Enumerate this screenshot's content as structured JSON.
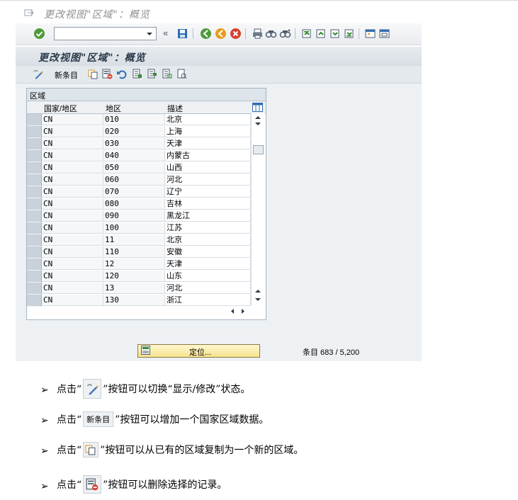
{
  "window": {
    "title": "更改视图\"区域\"：概览",
    "screen_title": "更改视图\"区域\"：概览"
  },
  "toolbar": {
    "command_field_value": "",
    "command_field_placeholder": ""
  },
  "app_toolbar": {
    "new_entries_label": "新条目"
  },
  "table": {
    "group_title": "区域",
    "headers": [
      "国家/地区",
      "地区",
      "描述"
    ],
    "rows": [
      {
        "country": "CN",
        "region": "010",
        "desc": "北京"
      },
      {
        "country": "CN",
        "region": "020",
        "desc": "上海"
      },
      {
        "country": "CN",
        "region": "030",
        "desc": "天津"
      },
      {
        "country": "CN",
        "region": "040",
        "desc": "内蒙古"
      },
      {
        "country": "CN",
        "region": "050",
        "desc": "山西"
      },
      {
        "country": "CN",
        "region": "060",
        "desc": "河北"
      },
      {
        "country": "CN",
        "region": "070",
        "desc": "辽宁"
      },
      {
        "country": "CN",
        "region": "080",
        "desc": "吉林"
      },
      {
        "country": "CN",
        "region": "090",
        "desc": "黑龙江"
      },
      {
        "country": "CN",
        "region": "100",
        "desc": "江苏"
      },
      {
        "country": "CN",
        "region": "11",
        "desc": "北京"
      },
      {
        "country": "CN",
        "region": "110",
        "desc": "安徽"
      },
      {
        "country": "CN",
        "region": "12",
        "desc": "天津"
      },
      {
        "country": "CN",
        "region": "120",
        "desc": "山东"
      },
      {
        "country": "CN",
        "region": "13",
        "desc": "河北"
      },
      {
        "country": "CN",
        "region": "130",
        "desc": "浙江"
      }
    ]
  },
  "position_button": {
    "label": "定位..."
  },
  "entry_counter": "条目 683 / 5,200",
  "instructions": [
    {
      "pre": "点击“",
      "post": "”按钮可以切换“显示/修改”状态。"
    },
    {
      "pre": "点击“",
      "mid": "新条目",
      "post": "”按钮可以增加一个国家区域数据。"
    },
    {
      "pre": "点击“",
      "post": "”按钮可以从已有的区域复制为一个新的区域。"
    },
    {
      "pre": "点击“",
      "post": "”按钮可以删除选择的记录。"
    }
  ],
  "colors": {
    "header_bg": "#dde4ea",
    "button_yellow": "#f5e38e",
    "selector_grey": "#c9d2da"
  },
  "icons": [
    "display-change-icon",
    "copy-icon",
    "delete-icon",
    "undo-icon",
    "select-all-icon",
    "select-block-icon",
    "deselect-all-icon",
    "print-icon",
    "enter-icon",
    "save-icon",
    "back-icon",
    "exit-icon",
    "cancel-icon",
    "find-icon",
    "find-next-icon",
    "first-page-icon",
    "prev-page-icon",
    "next-page-icon",
    "last-page-icon",
    "layout-icon",
    "position-icon",
    "table-settings-icon"
  ]
}
